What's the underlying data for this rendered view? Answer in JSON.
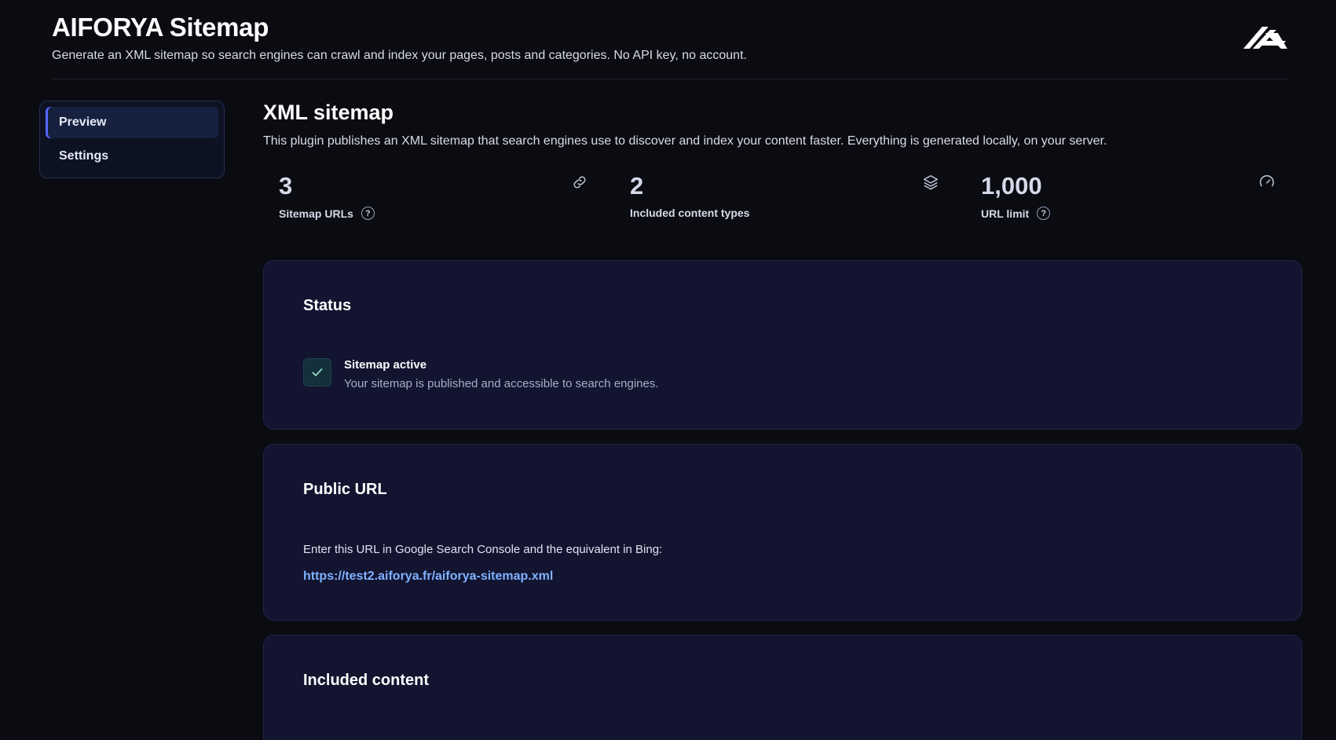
{
  "header": {
    "title": "AIFORYA Sitemap",
    "subtitle": "Generate an XML sitemap so search engines can crawl and index your pages, posts and categories. No API key, no account.",
    "logo_icon": "aiforya-logo-icon"
  },
  "sidebar": {
    "items": [
      {
        "label": "Preview",
        "active": true
      },
      {
        "label": "Settings",
        "active": false
      }
    ]
  },
  "main": {
    "title": "XML sitemap",
    "description": "This plugin publishes an XML sitemap that search engines use to discover and index your content faster. Everything is generated locally, on your server.",
    "stats": [
      {
        "value": "3",
        "label": "Sitemap URLs",
        "icon": "link-icon",
        "help": "?"
      },
      {
        "value": "2",
        "label": "Included content types",
        "icon": "layers-icon"
      },
      {
        "value": "1,000",
        "label": "URL limit",
        "icon": "gauge-icon",
        "help": "?"
      }
    ]
  },
  "status_card": {
    "title": "Status",
    "heading": "Sitemap active",
    "text": "Your sitemap is published and accessible to search engines."
  },
  "public_url_card": {
    "title": "Public URL",
    "intro": "Enter this URL in Google Search Console and the equivalent in Bing:",
    "url": "https://test2.aiforya.fr/aiforya-sitemap.xml"
  },
  "included_content_card": {
    "title": "Included content"
  },
  "colors": {
    "background": "#0b0b12",
    "card": "#121430",
    "accent": "#5468ff",
    "link": "#7fb2ff",
    "success": "#8fd9c6"
  }
}
